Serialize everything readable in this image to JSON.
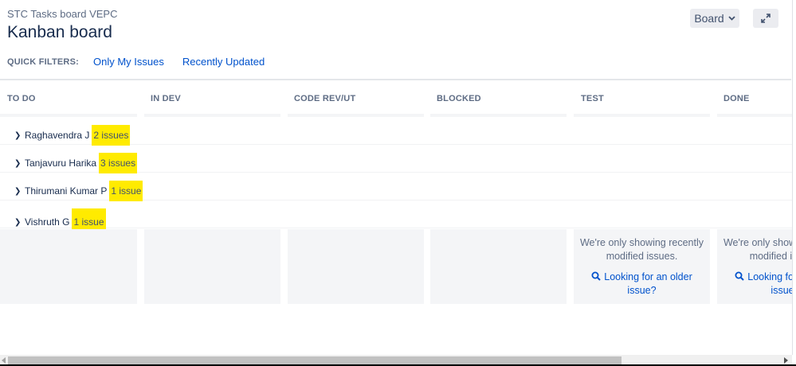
{
  "header": {
    "breadcrumb": "STC Tasks board VEPC",
    "title": "Kanban board",
    "board_button": "Board"
  },
  "quick_filters": {
    "label": "QUICK FILTERS:",
    "filters": [
      "Only My Issues",
      "Recently Updated"
    ]
  },
  "columns": [
    "TO DO",
    "IN DEV",
    "CODE REV/UT",
    "BLOCKED",
    "TEST",
    "DONE"
  ],
  "swimlanes": [
    {
      "name": "Raghavendra J",
      "count": "2 issues"
    },
    {
      "name": "Tanjavuru Harika",
      "count": "3 issues"
    },
    {
      "name": "Thirumani Kumar P",
      "count": "1 issue"
    },
    {
      "name": "Vishruth G",
      "count": "1 issue"
    }
  ],
  "notices": [
    {
      "text": "We're only showing recently modified issues.",
      "link": "Looking for an older issue?"
    },
    {
      "text": "We're only showing recently modified issues.",
      "link": "Looking for an older issue?"
    }
  ],
  "colors": {
    "highlight": "#ffeb00",
    "link": "#0052cc",
    "column_bg": "#f4f5f7"
  }
}
